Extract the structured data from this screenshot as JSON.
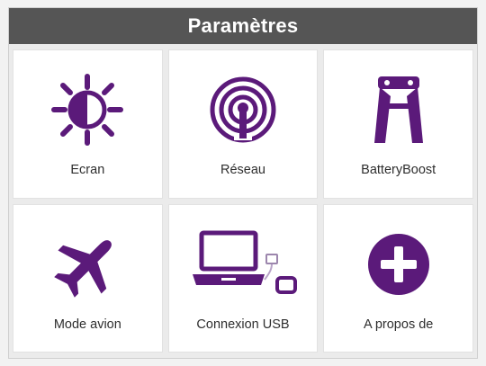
{
  "window": {
    "title": "Paramètres"
  },
  "colors": {
    "accent": "#5b1a7a",
    "titlebar": "#555555",
    "tile": "#ffffff"
  },
  "tiles": [
    {
      "label": "Ecran",
      "icon": "brightness-icon"
    },
    {
      "label": "Réseau",
      "icon": "wireless-signal-icon"
    },
    {
      "label": "BatteryBoost",
      "icon": "jumper-clamps-icon"
    },
    {
      "label": "Mode avion",
      "icon": "airplane-icon"
    },
    {
      "label": "Connexion USB",
      "icon": "laptop-usb-icon"
    },
    {
      "label": "A propos de",
      "icon": "plus-circle-icon"
    }
  ]
}
